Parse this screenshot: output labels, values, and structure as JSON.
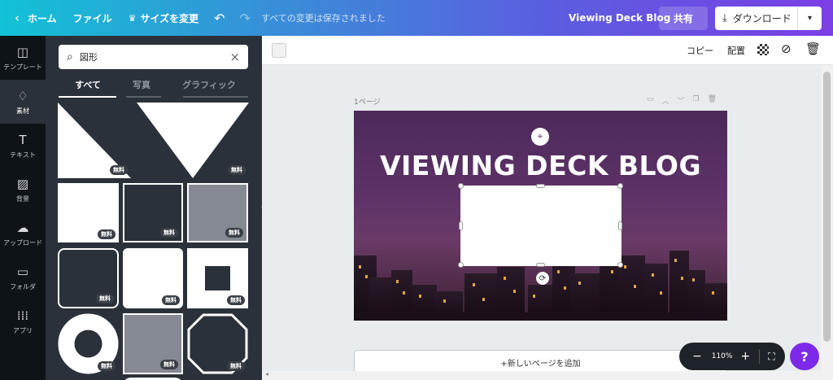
{
  "topbar": {
    "home_label": "ホーム",
    "file_label": "ファイル",
    "resize_label": "サイズを変更",
    "undo_icon": "undo-icon",
    "redo_icon": "redo-icon",
    "saved_status": "すべての変更は保存されました",
    "design_title": "Viewing Deck Blog",
    "share_label": "共有",
    "download_label": "ダウンロード"
  },
  "rail": {
    "items": [
      {
        "label": "テンプレート",
        "icon": "template-icon"
      },
      {
        "label": "素材",
        "icon": "elements-icon"
      },
      {
        "label": "テキスト",
        "icon": "text-icon"
      },
      {
        "label": "背景",
        "icon": "background-icon"
      },
      {
        "label": "アップロード",
        "icon": "upload-icon"
      },
      {
        "label": "フォルダ",
        "icon": "folder-icon"
      },
      {
        "label": "アプリ",
        "icon": "apps-icon"
      }
    ],
    "active_index": 1
  },
  "panel": {
    "search_value": "図形",
    "tabs": [
      "すべて",
      "写真",
      "グラフィック"
    ],
    "active_tab": 0,
    "free_badge": "無料"
  },
  "editor": {
    "copy_label": "コピー",
    "arrange_label": "配置",
    "page_label": "1ページ",
    "heading": "VIEWING DECK BLOG",
    "add_page_label": "+新しいページを追加",
    "zoom_value": "110%",
    "help_label": "?"
  },
  "colors": {
    "accent": "#7d2ae8",
    "rail_bg": "#0e1318",
    "panel_bg": "#2b313a",
    "canvas_bg": "#5e3268"
  }
}
